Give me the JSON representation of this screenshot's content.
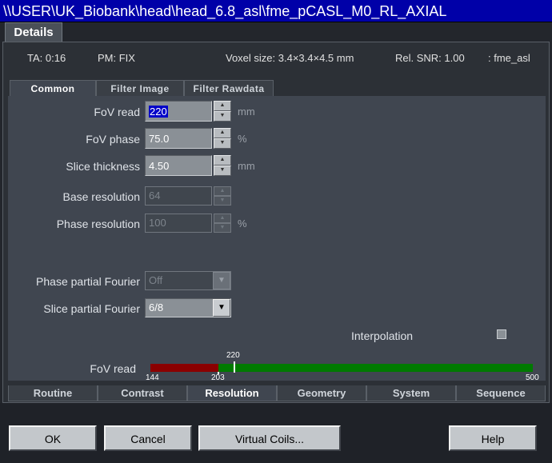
{
  "window": {
    "title": "\\\\USER\\UK_Biobank\\head\\head_6.8_asl\\fme_pCASL_M0_RL_AXIAL"
  },
  "details_tab": "Details",
  "info": {
    "ta": "TA: 0:16",
    "pm": "PM: FIX",
    "voxel": "Voxel size: 3.4×3.4×4.5 mm",
    "snr": "Rel. SNR: 1.00",
    "seq": ": fme_asl"
  },
  "subtabs": [
    "Common",
    "Filter Image",
    "Filter Rawdata"
  ],
  "params": {
    "fov_read": {
      "label": "FoV read",
      "value": "220",
      "unit": "mm"
    },
    "fov_phase": {
      "label": "FoV phase",
      "value": "75.0",
      "unit": "%"
    },
    "slice_thickness": {
      "label": "Slice thickness",
      "value": "4.50",
      "unit": "mm"
    },
    "base_resolution": {
      "label": "Base resolution",
      "value": "64"
    },
    "phase_resolution": {
      "label": "Phase resolution",
      "value": "100",
      "unit": "%"
    },
    "phase_partial_fourier": {
      "label": "Phase partial Fourier",
      "value": "Off"
    },
    "slice_partial_fourier": {
      "label": "Slice partial Fourier",
      "value": "6/8"
    },
    "interpolation": {
      "label": "Interpolation",
      "checked": false
    }
  },
  "range_bar": {
    "label": "FoV read",
    "current": "220",
    "min": "144",
    "limit": "203",
    "max": "500",
    "colors": {
      "invalid": "#8b0000",
      "valid": "#007a00"
    }
  },
  "bottom_tabs": [
    "Routine",
    "Contrast",
    "Resolution",
    "Geometry",
    "System",
    "Sequence"
  ],
  "active_bottom_tab": "Resolution",
  "buttons": {
    "ok": "OK",
    "cancel": "Cancel",
    "virtual_coils": "Virtual Coils...",
    "help": "Help"
  }
}
